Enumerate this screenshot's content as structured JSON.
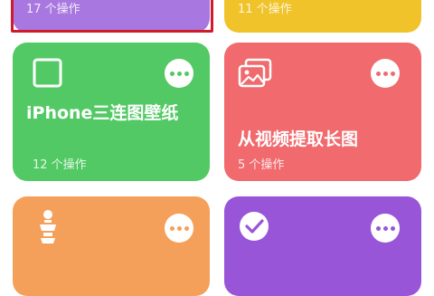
{
  "cards": [
    {
      "id": "top-left",
      "ops": "17 个操作",
      "color": "#a877e0"
    },
    {
      "id": "top-right",
      "ops": "11 个操作",
      "color": "#f1c32a"
    },
    {
      "id": "iphone",
      "title": "iPhone三连图壁纸",
      "ops": "12 个操作",
      "color": "#52c964",
      "icon": "square-outline-icon"
    },
    {
      "id": "video",
      "title": "从视频提取长图",
      "ops": "5 个操作",
      "color": "#f06a6e",
      "icon": "photos-icon"
    },
    {
      "id": "bottom-left",
      "color": "#f5a05a",
      "icon": "ice-cream-icon"
    },
    {
      "id": "bottom-right",
      "color": "#9955d8",
      "icon": "checkmark-circle-icon"
    }
  ],
  "more_icon": "ellipsis-icon",
  "highlight_color": "#d01c2a"
}
